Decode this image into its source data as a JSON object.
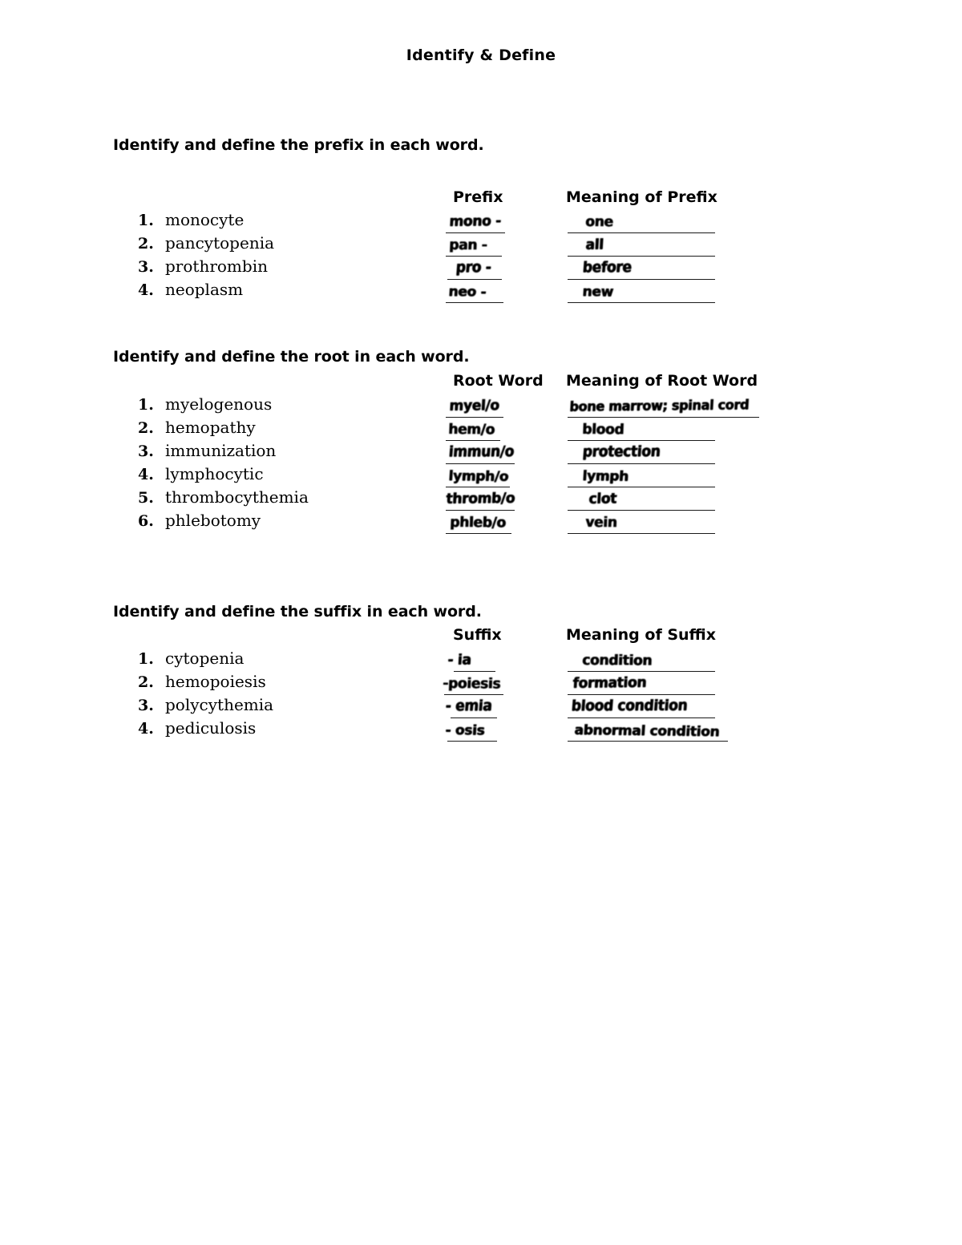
{
  "document": {
    "title": "Identify & Define"
  },
  "sections": [
    {
      "id": "prefix",
      "instruction": "Identify and define the prefix in each word.",
      "col_answer_header": "Prefix",
      "col_meaning_header": "Meaning of Prefix",
      "items": [
        {
          "num": "1.",
          "word": "monocyte",
          "answer": "mono -",
          "meaning": "one"
        },
        {
          "num": "2.",
          "word": "pancytopenia",
          "answer": "pan -",
          "meaning": "all"
        },
        {
          "num": "3.",
          "word": "prothrombin",
          "answer": "pro -",
          "meaning": "before"
        },
        {
          "num": "4.",
          "word": "neoplasm",
          "answer": "neo -",
          "meaning": "new"
        }
      ]
    },
    {
      "id": "root",
      "instruction": "Identify and define the root in each word.",
      "col_answer_header": "Root Word",
      "col_meaning_header": "Meaning of Root Word",
      "items": [
        {
          "num": "1.",
          "word": "myelogenous",
          "answer": "myel/o",
          "meaning": "bone marrow; spinal cord"
        },
        {
          "num": "2.",
          "word": "hemopathy",
          "answer": "hem/o",
          "meaning": "blood"
        },
        {
          "num": "3.",
          "word": "immunization",
          "answer": "immun/o",
          "meaning": "protection"
        },
        {
          "num": "4.",
          "word": "lymphocytic",
          "answer": "lymph/o",
          "meaning": "lymph"
        },
        {
          "num": "5.",
          "word": "thrombocythemia",
          "answer": "thromb/o",
          "meaning": "clot"
        },
        {
          "num": "6.",
          "word": "phlebotomy",
          "answer": "phleb/o",
          "meaning": "vein"
        }
      ]
    },
    {
      "id": "suffix",
      "instruction": "Identify and define the suffix in each word.",
      "col_answer_header": "Suffix",
      "col_meaning_header": "Meaning of Suffix",
      "items": [
        {
          "num": "1.",
          "word": "cytopenia",
          "answer": "- ia",
          "meaning": "condition"
        },
        {
          "num": "2.",
          "word": "hemopoiesis",
          "answer": "-poiesis",
          "meaning": "formation"
        },
        {
          "num": "3.",
          "word": "polycythemia",
          "answer": "- emia",
          "meaning": "blood condition"
        },
        {
          "num": "4.",
          "word": "pediculosis",
          "answer": "- osis",
          "meaning": "abnormal condition"
        }
      ]
    }
  ]
}
